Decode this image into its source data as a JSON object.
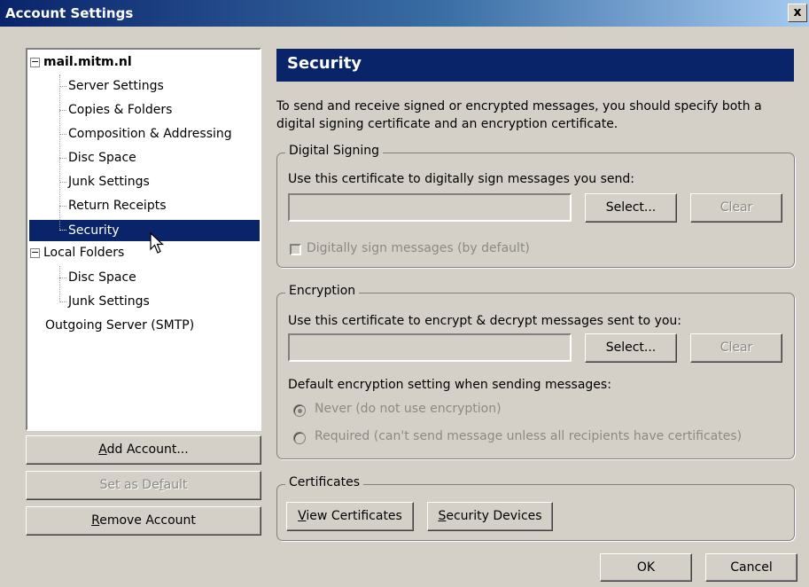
{
  "window": {
    "title": "Account Settings",
    "close_glyph": "x"
  },
  "tree": {
    "account": "mail.mitm.nl",
    "account_children": [
      "Server Settings",
      "Copies & Folders",
      "Composition & Addressing",
      "Disc Space",
      "Junk Settings",
      "Return Receipts",
      "Security"
    ],
    "local": "Local Folders",
    "local_children": [
      "Disc Space",
      "Junk Settings"
    ],
    "smtp": "Outgoing Server (SMTP)",
    "selected": "Security"
  },
  "left_buttons": {
    "add": {
      "pre": "",
      "key": "A",
      "post": "dd Account..."
    },
    "default": {
      "pre": "Set as De",
      "key": "f",
      "post": "ault"
    },
    "remove": {
      "pre": "",
      "key": "R",
      "post": "emove Account"
    }
  },
  "panel": {
    "title": "Security",
    "description": "To send and receive signed or encrypted messages, you should specify both a digital signing certificate and an encryption certificate."
  },
  "signing": {
    "legend": "Digital Signing",
    "instruction": "Use this certificate to digitally sign messages you send:",
    "cert_value": "",
    "select_label": "Select...",
    "clear_label": "Clear",
    "checkbox_label": "Digitally sign messages (by default)",
    "checkbox_checked": false
  },
  "encryption": {
    "legend": "Encryption",
    "instruction": "Use this certificate to encrypt & decrypt messages sent to you:",
    "cert_value": "",
    "select_label": "Select...",
    "clear_label": "Clear",
    "default_label": "Default encryption setting when sending messages:",
    "option_never": "Never (do not use encryption)",
    "option_required": "Required (can't send message unless all recipients have certificates)",
    "selected_option": "never"
  },
  "certificates": {
    "legend": "Certificates",
    "view": {
      "pre": "",
      "key": "V",
      "post": "iew Certificates"
    },
    "devices": {
      "pre": "",
      "key": "S",
      "post": "ecurity Devices"
    }
  },
  "dialog_buttons": {
    "ok": "OK",
    "cancel": "Cancel"
  }
}
